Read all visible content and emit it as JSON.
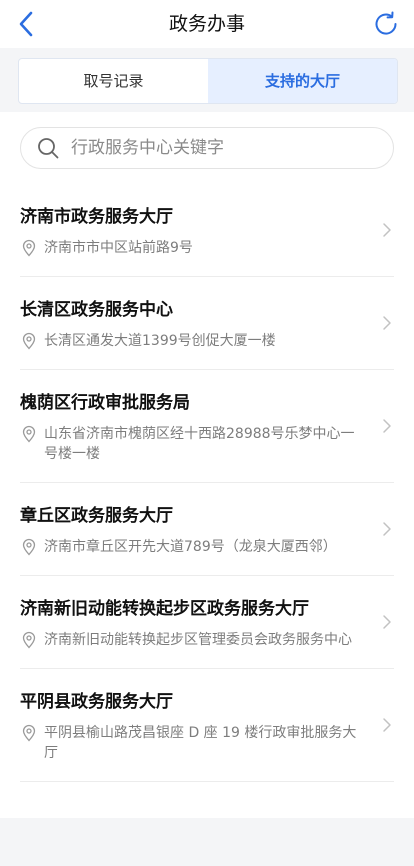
{
  "header": {
    "title": "政务办事",
    "back_icon": "chevron-left-icon",
    "refresh_icon": "refresh-icon",
    "accent": "#2b6de0"
  },
  "tabs": [
    {
      "label": "取号记录",
      "active": false
    },
    {
      "label": "支持的大厅",
      "active": true
    }
  ],
  "search": {
    "placeholder": "行政服务中心关键字",
    "value": ""
  },
  "halls": [
    {
      "name": "济南市政务服务大厅",
      "address": "济南市市中区站前路9号"
    },
    {
      "name": "长清区政务服务中心",
      "address": "长清区通发大道1399号创促大厦一楼"
    },
    {
      "name": "槐荫区行政审批服务局",
      "address": "山东省济南市槐荫区经十西路28988号乐梦中心一号楼一楼"
    },
    {
      "name": "章丘区政务服务大厅",
      "address": "济南市章丘区开先大道789号（龙泉大厦西邻）"
    },
    {
      "name": "济南新旧动能转换起步区政务服务大厅",
      "address": "济南新旧动能转换起步区管理委员会政务服务中心"
    },
    {
      "name": "平阴县政务服务大厅",
      "address": "平阴县榆山路茂昌银座 D 座 19 楼行政审批服务大厅"
    }
  ]
}
